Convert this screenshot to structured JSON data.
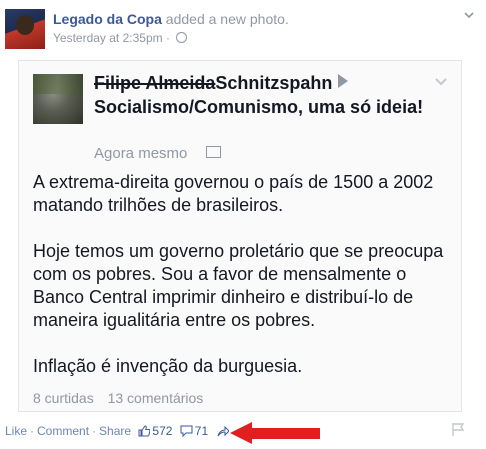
{
  "post": {
    "page_name": "Legado da Copa",
    "action": "added a new photo.",
    "time": "Yesterday at 2:35pm",
    "time_sep": "·"
  },
  "shared": {
    "struck_name": "Filipe Almeida",
    "name_rest": "Schnitzspahn",
    "title": "Socialismo/Comunismo, uma só ideia!",
    "time": "Agora mesmo",
    "paragraphs": [
      "A extrema-direita governou o país de 1500 a 2002 matando trilhões de brasileiros.",
      "Hoje temos um governo proletário que se preocupa com os pobres. Sou a favor de mensalmente o Banco Central imprimir dinheiro e distribuí-lo de maneira igualitária entre os pobres.",
      "Inflação é invenção da burguesia."
    ],
    "likes": "8 curtidas",
    "comments": "13 comentários"
  },
  "actions": {
    "like": "Like",
    "comment": "Comment",
    "share": "Share",
    "sep": "·",
    "like_count": "572",
    "comment_count": "71"
  },
  "colors": {
    "link": "#3b5998",
    "muted": "#9197a3",
    "arrow": "#e02020"
  }
}
